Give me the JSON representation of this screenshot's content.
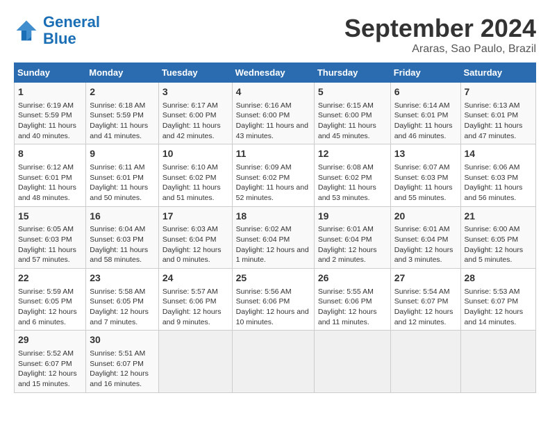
{
  "header": {
    "logo_line1": "General",
    "logo_line2": "Blue",
    "title": "September 2024",
    "subtitle": "Araras, Sao Paulo, Brazil"
  },
  "weekdays": [
    "Sunday",
    "Monday",
    "Tuesday",
    "Wednesday",
    "Thursday",
    "Friday",
    "Saturday"
  ],
  "weeks": [
    [
      {
        "day": "1",
        "info": "Sunrise: 6:19 AM\nSunset: 5:59 PM\nDaylight: 11 hours and 40 minutes."
      },
      {
        "day": "2",
        "info": "Sunrise: 6:18 AM\nSunset: 5:59 PM\nDaylight: 11 hours and 41 minutes."
      },
      {
        "day": "3",
        "info": "Sunrise: 6:17 AM\nSunset: 6:00 PM\nDaylight: 11 hours and 42 minutes."
      },
      {
        "day": "4",
        "info": "Sunrise: 6:16 AM\nSunset: 6:00 PM\nDaylight: 11 hours and 43 minutes."
      },
      {
        "day": "5",
        "info": "Sunrise: 6:15 AM\nSunset: 6:00 PM\nDaylight: 11 hours and 45 minutes."
      },
      {
        "day": "6",
        "info": "Sunrise: 6:14 AM\nSunset: 6:01 PM\nDaylight: 11 hours and 46 minutes."
      },
      {
        "day": "7",
        "info": "Sunrise: 6:13 AM\nSunset: 6:01 PM\nDaylight: 11 hours and 47 minutes."
      }
    ],
    [
      {
        "day": "8",
        "info": "Sunrise: 6:12 AM\nSunset: 6:01 PM\nDaylight: 11 hours and 48 minutes."
      },
      {
        "day": "9",
        "info": "Sunrise: 6:11 AM\nSunset: 6:01 PM\nDaylight: 11 hours and 50 minutes."
      },
      {
        "day": "10",
        "info": "Sunrise: 6:10 AM\nSunset: 6:02 PM\nDaylight: 11 hours and 51 minutes."
      },
      {
        "day": "11",
        "info": "Sunrise: 6:09 AM\nSunset: 6:02 PM\nDaylight: 11 hours and 52 minutes."
      },
      {
        "day": "12",
        "info": "Sunrise: 6:08 AM\nSunset: 6:02 PM\nDaylight: 11 hours and 53 minutes."
      },
      {
        "day": "13",
        "info": "Sunrise: 6:07 AM\nSunset: 6:03 PM\nDaylight: 11 hours and 55 minutes."
      },
      {
        "day": "14",
        "info": "Sunrise: 6:06 AM\nSunset: 6:03 PM\nDaylight: 11 hours and 56 minutes."
      }
    ],
    [
      {
        "day": "15",
        "info": "Sunrise: 6:05 AM\nSunset: 6:03 PM\nDaylight: 11 hours and 57 minutes."
      },
      {
        "day": "16",
        "info": "Sunrise: 6:04 AM\nSunset: 6:03 PM\nDaylight: 11 hours and 58 minutes."
      },
      {
        "day": "17",
        "info": "Sunrise: 6:03 AM\nSunset: 6:04 PM\nDaylight: 12 hours and 0 minutes."
      },
      {
        "day": "18",
        "info": "Sunrise: 6:02 AM\nSunset: 6:04 PM\nDaylight: 12 hours and 1 minute."
      },
      {
        "day": "19",
        "info": "Sunrise: 6:01 AM\nSunset: 6:04 PM\nDaylight: 12 hours and 2 minutes."
      },
      {
        "day": "20",
        "info": "Sunrise: 6:01 AM\nSunset: 6:04 PM\nDaylight: 12 hours and 3 minutes."
      },
      {
        "day": "21",
        "info": "Sunrise: 6:00 AM\nSunset: 6:05 PM\nDaylight: 12 hours and 5 minutes."
      }
    ],
    [
      {
        "day": "22",
        "info": "Sunrise: 5:59 AM\nSunset: 6:05 PM\nDaylight: 12 hours and 6 minutes."
      },
      {
        "day": "23",
        "info": "Sunrise: 5:58 AM\nSunset: 6:05 PM\nDaylight: 12 hours and 7 minutes."
      },
      {
        "day": "24",
        "info": "Sunrise: 5:57 AM\nSunset: 6:06 PM\nDaylight: 12 hours and 9 minutes."
      },
      {
        "day": "25",
        "info": "Sunrise: 5:56 AM\nSunset: 6:06 PM\nDaylight: 12 hours and 10 minutes."
      },
      {
        "day": "26",
        "info": "Sunrise: 5:55 AM\nSunset: 6:06 PM\nDaylight: 12 hours and 11 minutes."
      },
      {
        "day": "27",
        "info": "Sunrise: 5:54 AM\nSunset: 6:07 PM\nDaylight: 12 hours and 12 minutes."
      },
      {
        "day": "28",
        "info": "Sunrise: 5:53 AM\nSunset: 6:07 PM\nDaylight: 12 hours and 14 minutes."
      }
    ],
    [
      {
        "day": "29",
        "info": "Sunrise: 5:52 AM\nSunset: 6:07 PM\nDaylight: 12 hours and 15 minutes."
      },
      {
        "day": "30",
        "info": "Sunrise: 5:51 AM\nSunset: 6:07 PM\nDaylight: 12 hours and 16 minutes."
      },
      {
        "day": "",
        "info": ""
      },
      {
        "day": "",
        "info": ""
      },
      {
        "day": "",
        "info": ""
      },
      {
        "day": "",
        "info": ""
      },
      {
        "day": "",
        "info": ""
      }
    ]
  ]
}
